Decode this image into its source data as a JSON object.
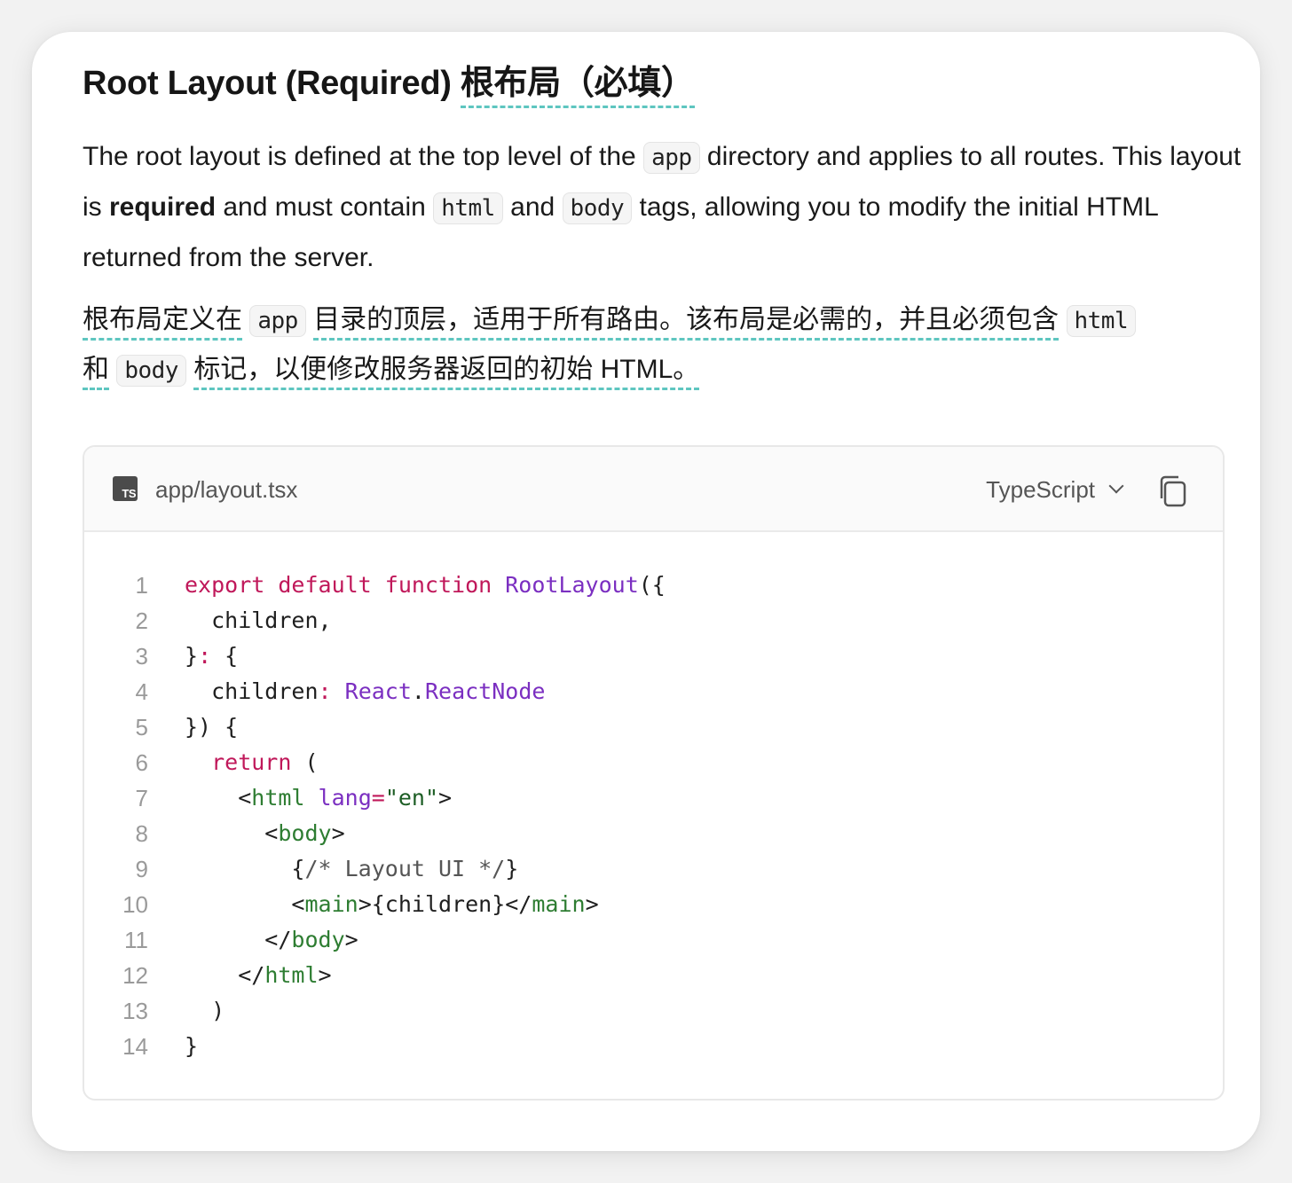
{
  "heading": {
    "en": "Root Layout (Required) ",
    "zh": "根布局（必填）"
  },
  "para_en": {
    "t1": "The root layout is defined at the top level of the ",
    "c1": "app",
    "t2": " directory and applies to all routes. This layout is ",
    "b1": "required",
    "t3": " and must contain ",
    "c2": "html",
    "t4": " and ",
    "c3": "body",
    "t5": " tags, allowing you to modify the initial HTML returned from the server."
  },
  "para_zh": {
    "t1": "根布局定义在",
    "c1": "app",
    "t2": "目录的顶层，适用于所有路由。该布局是必需的，并且必须包含",
    "c2": "html",
    "t3": "和",
    "c3": "body",
    "t4": "标记，以便修改服务器返回的初始 HTML。"
  },
  "codeblock": {
    "file_icon_label": "TS",
    "filename": "app/layout.tsx",
    "language": "TypeScript",
    "copy_icon": "copy-icon",
    "lines": [
      {
        "n": "1",
        "parts": [
          [
            "kw",
            "export default function "
          ],
          [
            "fn",
            "RootLayout"
          ],
          [
            "",
            "({"
          ]
        ]
      },
      {
        "n": "2",
        "parts": [
          [
            "",
            "  children,"
          ]
        ]
      },
      {
        "n": "3",
        "parts": [
          [
            "",
            "}"
          ],
          [
            "kw",
            ":"
          ],
          [
            "",
            " {"
          ]
        ]
      },
      {
        "n": "4",
        "parts": [
          [
            "",
            "  children"
          ],
          [
            "kw",
            ":"
          ],
          [
            "",
            " "
          ],
          [
            "fn",
            "React"
          ],
          [
            "",
            "."
          ],
          [
            "fn",
            "ReactNode"
          ]
        ]
      },
      {
        "n": "5",
        "parts": [
          [
            "",
            "}) {"
          ]
        ]
      },
      {
        "n": "6",
        "parts": [
          [
            "kw",
            "  return"
          ],
          [
            "",
            " ("
          ]
        ]
      },
      {
        "n": "7",
        "parts": [
          [
            "",
            "    <"
          ],
          [
            "tg",
            "html"
          ],
          [
            "",
            " "
          ],
          [
            "at",
            "lang"
          ],
          [
            "kw",
            "="
          ],
          [
            "st",
            "\"en\""
          ],
          [
            "",
            ">"
          ]
        ]
      },
      {
        "n": "8",
        "parts": [
          [
            "",
            "      <"
          ],
          [
            "tg",
            "body"
          ],
          [
            "",
            ">"
          ]
        ]
      },
      {
        "n": "9",
        "parts": [
          [
            "",
            "        {"
          ],
          [
            "cm",
            "/* Layout UI */"
          ],
          [
            "",
            "}"
          ]
        ]
      },
      {
        "n": "10",
        "parts": [
          [
            "",
            "        <"
          ],
          [
            "tg",
            "main"
          ],
          [
            "",
            ">{children}</"
          ],
          [
            "tg",
            "main"
          ],
          [
            "",
            ">"
          ]
        ]
      },
      {
        "n": "11",
        "parts": [
          [
            "",
            "      </"
          ],
          [
            "tg",
            "body"
          ],
          [
            "",
            ">"
          ]
        ]
      },
      {
        "n": "12",
        "parts": [
          [
            "",
            "    </"
          ],
          [
            "tg",
            "html"
          ],
          [
            "",
            ">"
          ]
        ]
      },
      {
        "n": "13",
        "parts": [
          [
            "",
            "  )"
          ]
        ]
      },
      {
        "n": "14",
        "parts": [
          [
            "",
            "}"
          ]
        ]
      }
    ]
  },
  "colors": {
    "underline": "#5ec6c0",
    "keyword": "#c0185a",
    "function": "#7b2fc1",
    "tag": "#2e7d32"
  }
}
